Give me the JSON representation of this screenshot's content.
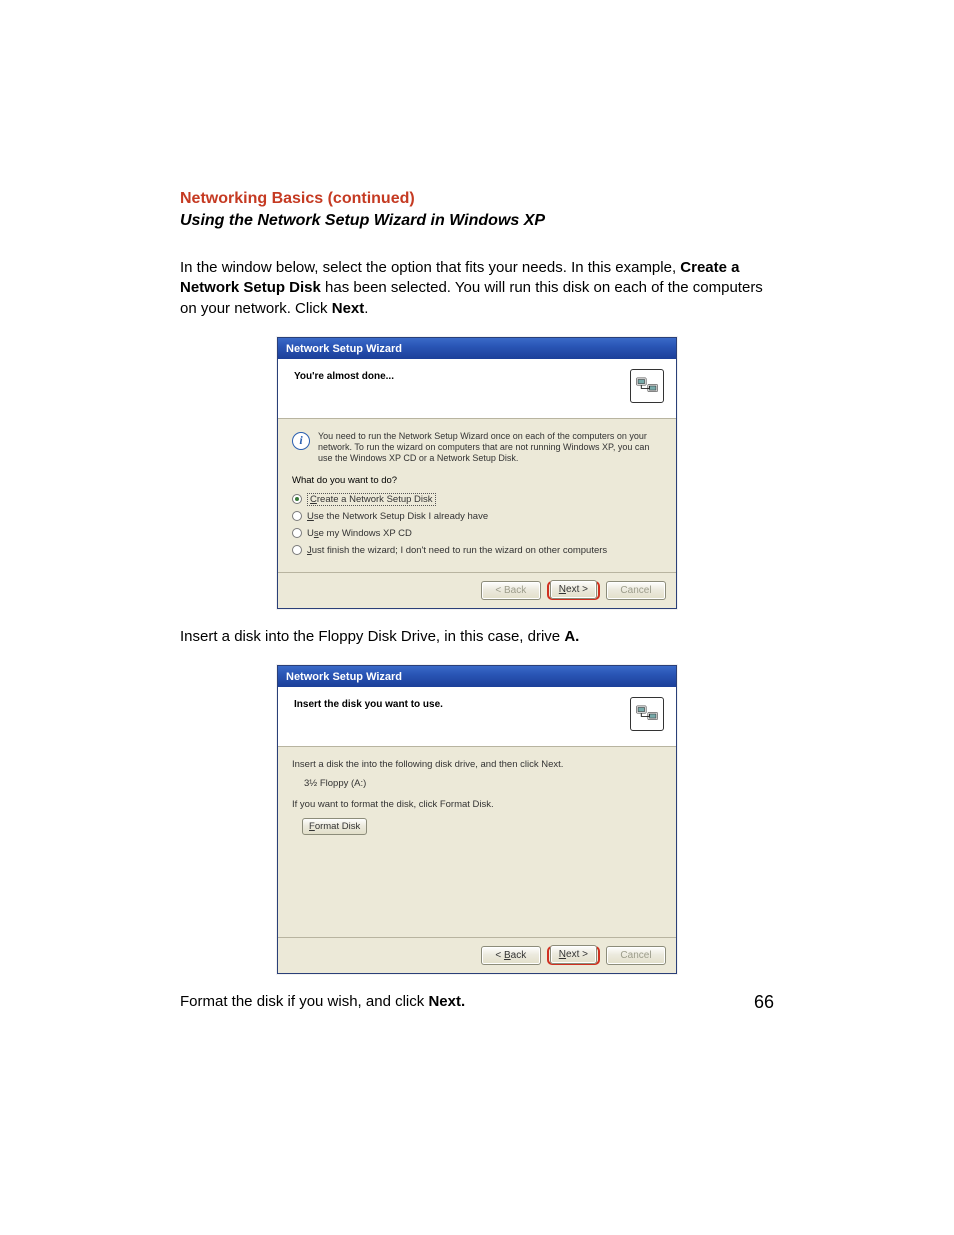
{
  "headings": {
    "section": "Networking Basics (continued)",
    "subsection": "Using the Network Setup Wizard in Windows XP"
  },
  "para1": {
    "t1": "In the window below, select the option that fits your needs.  In this example, ",
    "b1": "Create a Network Setup Disk",
    "t2": " has been selected.  You will run this disk on each of the computers on your network.  Click ",
    "b2": "Next",
    "t3": "."
  },
  "para2": {
    "t1": "Insert a disk into the Floppy Disk Drive, in this case, drive ",
    "b1": "A.",
    "t2": ""
  },
  "para3": {
    "t1": "Format the disk if you wish, and click ",
    "b1": "Next.",
    "t2": ""
  },
  "page_number": "66",
  "wizard1": {
    "title": "Network Setup Wizard",
    "header": "You're almost done...",
    "info": "You need to run the Network Setup Wizard once on each of the computers on your network. To run the wizard on computers that are not running Windows XP, you can use the Windows XP CD or a Network Setup Disk.",
    "prompt": "What do you want to do?",
    "options": {
      "o1_u": "C",
      "o1_r": "reate a Network Setup Disk",
      "o2_u": "U",
      "o2_r": "se the Network Setup Disk I already have",
      "o3_pre": "U",
      "o3_u": "s",
      "o3_r": "e my Windows XP CD",
      "o4_u": "J",
      "o4_r": "ust finish the wizard; I don't need to run the wizard on other computers"
    },
    "buttons": {
      "back": "< Back",
      "next_u": "N",
      "next_r": "ext >",
      "cancel": "Cancel"
    }
  },
  "wizard2": {
    "title": "Network Setup Wizard",
    "header": "Insert the disk you want to use.",
    "line1": "Insert a disk the into the following disk drive, and then click Next.",
    "drive": "3½ Floppy (A:)",
    "line2": "If you want to format the disk, click Format Disk.",
    "format_u": "F",
    "format_r": "ormat Disk",
    "buttons": {
      "back_pre": "< ",
      "back_u": "B",
      "back_r": "ack",
      "next_u": "N",
      "next_r": "ext >",
      "cancel": "Cancel"
    }
  }
}
